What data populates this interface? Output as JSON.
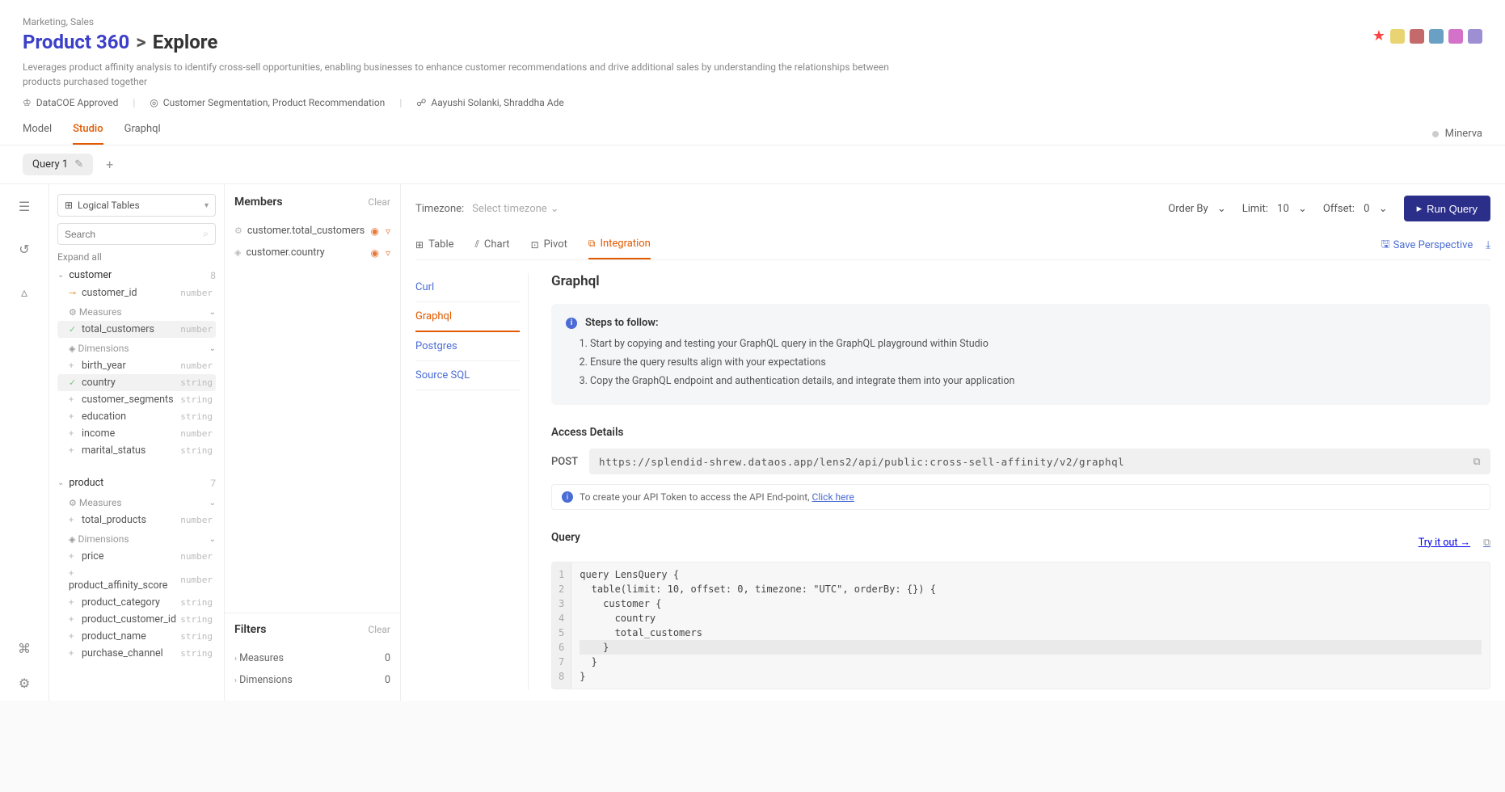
{
  "header": {
    "categories": "Marketing, Sales",
    "title_main": "Product 360",
    "title_sep": ">",
    "title_sub": "Explore",
    "description": "Leverages product affinity analysis to identify cross-sell opportunities, enabling businesses to enhance customer recommendations and drive additional sales by understanding the relationships between products purchased together",
    "meta_approved": "DataCOE Approved",
    "meta_tags": "Customer Segmentation, Product Recommendation",
    "meta_people": "Aayushi Solanki, Shraddha Ade"
  },
  "tabs": {
    "model": "Model",
    "studio": "Studio",
    "graphql": "Graphql"
  },
  "status": {
    "label": "Minerva"
  },
  "qtabs": {
    "q1": "Query 1"
  },
  "schema": {
    "selector": "Logical Tables",
    "search_placeholder": "Search",
    "expand_all": "Expand all",
    "customer": {
      "name": "customer",
      "count": "8"
    },
    "measures_label": "Measures",
    "dimensions_label": "Dimensions",
    "fields": {
      "customer_id": {
        "name": "customer_id",
        "type": "number"
      },
      "total_customers": {
        "name": "total_customers",
        "type": "number"
      },
      "birth_year": {
        "name": "birth_year",
        "type": "number"
      },
      "country": {
        "name": "country",
        "type": "string"
      },
      "customer_segments": {
        "name": "customer_segments",
        "type": "string"
      },
      "education": {
        "name": "education",
        "type": "string"
      },
      "income": {
        "name": "income",
        "type": "number"
      },
      "marital_status": {
        "name": "marital_status",
        "type": "string"
      }
    },
    "product": {
      "name": "product",
      "count": "7"
    },
    "pfields": {
      "total_products": {
        "name": "total_products",
        "type": "number"
      },
      "price": {
        "name": "price",
        "type": "number"
      },
      "product_affinity_score": {
        "name": "product_affinity_score",
        "type": "number"
      },
      "product_category": {
        "name": "product_category",
        "type": "string"
      },
      "product_customer_id": {
        "name": "product_customer_id",
        "type": "string"
      },
      "product_name": {
        "name": "product_name",
        "type": "string"
      },
      "purchase_channel": {
        "name": "purchase_channel",
        "type": "string"
      }
    }
  },
  "members": {
    "title": "Members",
    "clear": "Clear",
    "items": {
      "i0": "customer.total_customers",
      "i1": "customer.country"
    }
  },
  "filters": {
    "title": "Filters",
    "clear": "Clear",
    "measures": "Measures",
    "mcount": "0",
    "dimensions": "Dimensions",
    "dcount": "0"
  },
  "topbar": {
    "tz_label": "Timezone:",
    "tz_sel": "Select timezone",
    "order": "Order By",
    "limit_label": "Limit:",
    "limit_val": "10",
    "offset_label": "Offset:",
    "offset_val": "0",
    "run": "Run Query"
  },
  "viewtabs": {
    "table": "Table",
    "chart": "Chart",
    "pivot": "Pivot",
    "integration": "Integration",
    "save": "Save Perspective"
  },
  "inav": {
    "curl": "Curl",
    "graphql": "Graphql",
    "postgres": "Postgres",
    "sourcesql": "Source SQL"
  },
  "integ": {
    "title": "Graphql",
    "steps_hdr": "Steps to follow:",
    "step1": "Start by copying and testing your GraphQL query in the GraphQL playground within Studio",
    "step2": "Ensure the query results align with your expectations",
    "step3": "Copy the GraphQL endpoint and authentication details, and integrate them into your application",
    "access_title": "Access Details",
    "method": "POST",
    "url": "https://splendid-shrew.dataos.app/lens2/api/public:cross-sell-affinity/v2/graphql",
    "token_text": "To create your API Token to access the API End-point, ",
    "token_link": "Click here",
    "query_title": "Query",
    "try": "Try it out →",
    "gutter": "1\n2\n3\n4\n5\n6\n7\n8",
    "code_l1": "query LensQuery {",
    "code_l2": "  table(limit: 10, offset: 0, timezone: \"UTC\", orderBy: {}) {",
    "code_l3": "    customer {",
    "code_l4": "      country",
    "code_l5": "      total_customers",
    "code_l6": "    }",
    "code_l7": "  }",
    "code_l8": "}"
  }
}
